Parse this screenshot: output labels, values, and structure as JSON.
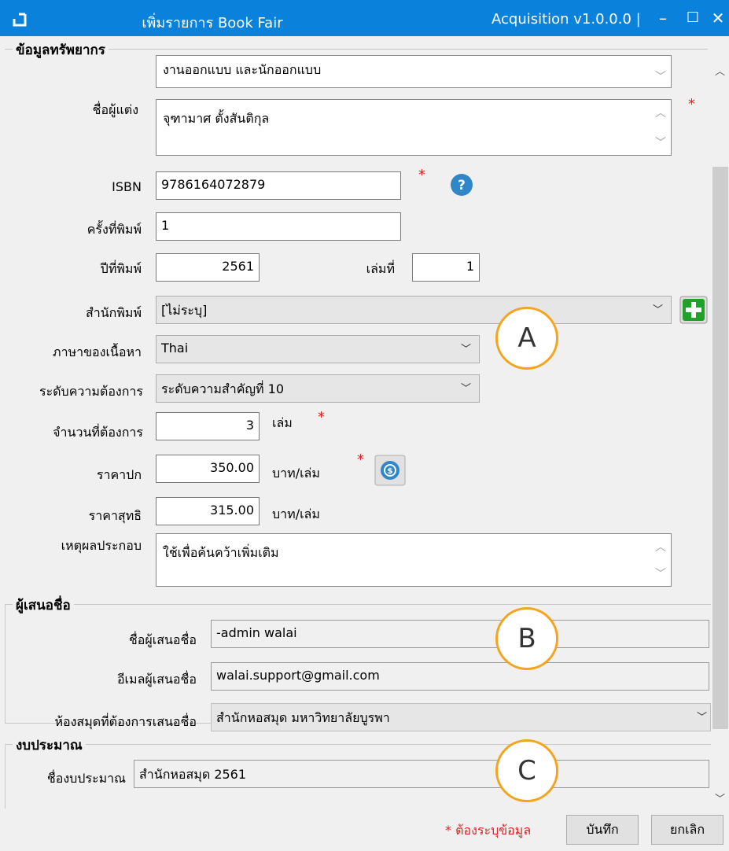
{
  "window": {
    "title": "เพิ่มรายการ Book Fair",
    "version": "Acquisition v1.0.0.0 |",
    "minimize_label": "–",
    "maximize_label": "☐",
    "close_label": "✕"
  },
  "resource_section": {
    "title": "ข้อมูลทรัพยากร",
    "title_field_partial": "งานออกแบบ และนักออกแบบ",
    "author_label": "ชื่อผู้แต่ง",
    "author_value": "จุฑามาศ ตั้งสันติกุล",
    "isbn_label": "ISBN",
    "isbn_value": "9786164072879",
    "edition_label": "ครั้งที่พิมพ์",
    "edition_value": "1",
    "year_label": "ปีที่พิมพ์",
    "year_value": "2561",
    "volume_label": "เล่มที่",
    "volume_value": "1",
    "publisher_label": "สำนักพิมพ์",
    "publisher_value": "[ไม่ระบุ]",
    "language_label": "ภาษาของเนื้อหา",
    "language_value": "Thai",
    "priority_label": "ระดับความต้องการ",
    "priority_value": "ระดับความสำคัญที่ 10",
    "quantity_label": "จำนวนที่ต้องการ",
    "quantity_value": "3",
    "quantity_unit": "เล่ม",
    "list_price_label": "ราคาปก",
    "list_price_value": "350.00",
    "list_price_unit": "บาท/เล่ม",
    "net_price_label": "ราคาสุทธิ",
    "net_price_value": "315.00",
    "net_price_unit": "บาท/เล่ม",
    "reason_label": "เหตุผลประกอบ",
    "reason_value": "ใช้เพื่อค้นคว้าเพิ่มเติม",
    "required_mark": "*"
  },
  "proposer_section": {
    "title": "ผู้เสนอชื่อ",
    "name_label": "ชื่อผู้เสนอชื่อ",
    "name_value": "-admin  walai",
    "email_label": "อีเมลผู้เสนอชื่อ",
    "email_value": "walai.support@gmail.com",
    "library_label": "ห้องสมุดที่ต้องการเสนอชื่อ",
    "library_value": "สำนักหอสมุด มหาวิทยาลัยบูรพา"
  },
  "budget_section": {
    "title": "งบประมาณ",
    "budget_label": "ชื่องบประมาณ",
    "budget_value": "สำนักหอสมุด 2561"
  },
  "callouts": {
    "a": "A",
    "b": "B",
    "c": "C"
  },
  "footer": {
    "required_note": "* ต้องระบุข้อมูล",
    "save_label": "บันทึก",
    "cancel_label": "ยกเลิก"
  },
  "colors": {
    "titlebar": "#0a82db",
    "required": "#e02020",
    "callout_border": "#f4a41d",
    "add_button": "#1fa12a",
    "help_icon": "#2f86c9"
  },
  "icons": [
    "app-icon",
    "help-icon",
    "add-publisher-icon",
    "currency-convert-icon",
    "chevron-down-icon"
  ]
}
